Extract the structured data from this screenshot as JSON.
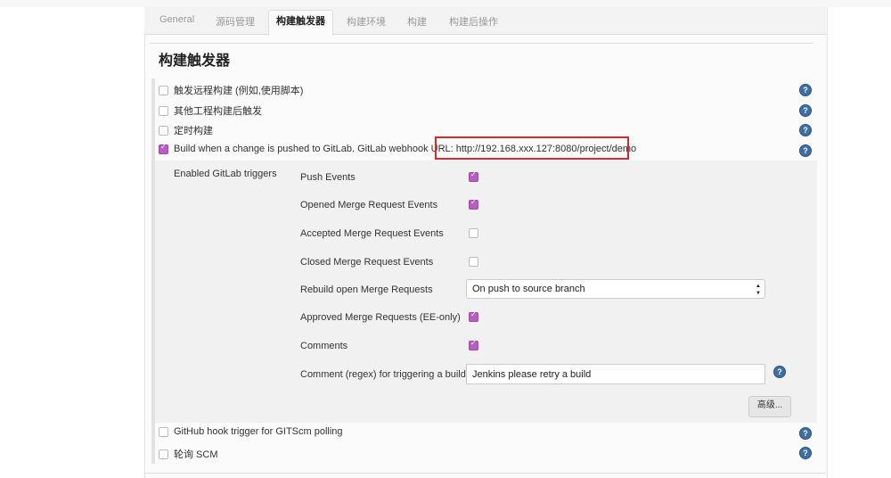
{
  "tabs": [
    {
      "label": "General"
    },
    {
      "label": "源码管理"
    },
    {
      "label": "构建触发器"
    },
    {
      "label": "构建环境"
    },
    {
      "label": "构建"
    },
    {
      "label": "构建后操作"
    }
  ],
  "section_title": "构建触发器",
  "triggers": [
    {
      "label": "触发远程构建 (例如,使用脚本)",
      "checked": false
    },
    {
      "label": "其他工程构建后触发",
      "checked": false
    },
    {
      "label": "定时构建",
      "checked": false
    },
    {
      "label": "Build when a change is pushed to GitLab. GitLab webhook URL: http://192.168.xxx.127:8080/project/demo",
      "checked": true
    },
    {
      "label": "GitHub hook trigger for GITScm polling",
      "checked": false
    },
    {
      "label": "轮询 SCM",
      "checked": false
    }
  ],
  "gitlab": {
    "section_label": "Enabled GitLab triggers",
    "options": [
      {
        "label": "Push Events",
        "checked": true
      },
      {
        "label": "Opened Merge Request Events",
        "checked": true
      },
      {
        "label": "Accepted Merge Request Events",
        "checked": false
      },
      {
        "label": "Closed Merge Request Events",
        "checked": false
      },
      {
        "label": "Approved Merge Requests (EE-only)",
        "checked": true
      },
      {
        "label": "Comments",
        "checked": true
      }
    ],
    "rebuild_label": "Rebuild open Merge Requests",
    "rebuild_value": "On push to source branch",
    "comment_label": "Comment (regex) for triggering a build",
    "comment_value": "Jenkins please retry a build",
    "advanced_label": "高级..."
  },
  "help_glyph": "?",
  "colors": {
    "accent": "#b95ec0",
    "help": "#3d6fa5",
    "highlight": "#e0262d"
  }
}
